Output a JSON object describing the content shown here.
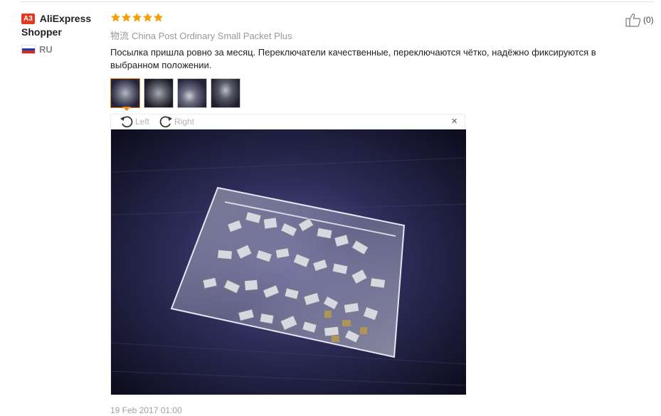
{
  "reviewer": {
    "badge": "A3",
    "name": "AliExpress Shopper",
    "country_code": "RU",
    "flag_colors": [
      "#ffffff",
      "#1c3fa8",
      "#d52b1e"
    ]
  },
  "review": {
    "rating": 5,
    "star_color": "#f59e0b",
    "logistics_label": "物流",
    "logistics_value": "China Post Ordinary Small Packet Plus",
    "text": "Посылка пришла ровно за месяц. Переключатели качественные, переключаются чётко, надёжно фиксируются в выбранном положении.",
    "date": "19 Feb 2017 01:00"
  },
  "helpful": {
    "count": "(0)"
  },
  "photos": {
    "thumbnail_count": 4,
    "active_index": 0
  },
  "viewer": {
    "rotate_left_label": "Left",
    "rotate_right_label": "Right",
    "close_glyph": "×"
  }
}
